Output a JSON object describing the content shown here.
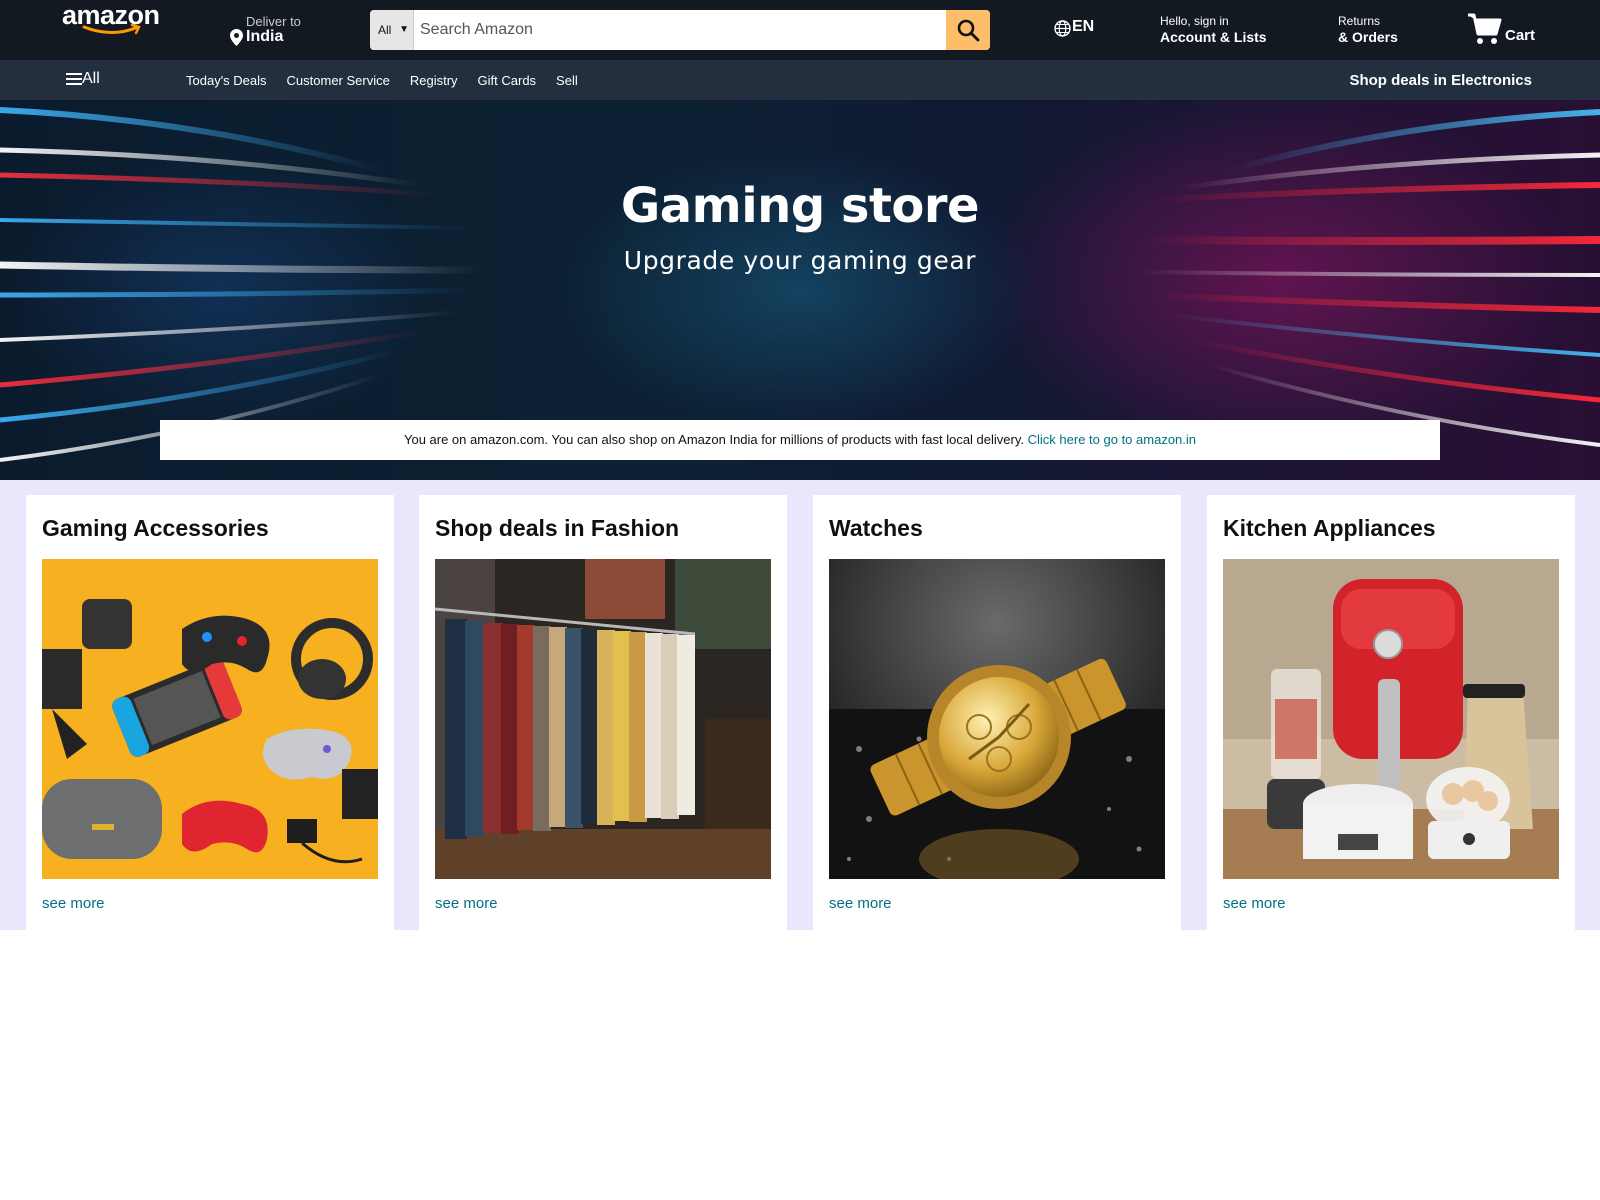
{
  "header": {
    "logo_text": "amazon",
    "deliver_label": "Deliver to",
    "deliver_location": "India",
    "search_category": "All",
    "search_placeholder": "Search Amazon",
    "language": "EN",
    "account_line1": "Hello, sign in",
    "account_line2": "Account & Lists",
    "returns_line1": "Returns",
    "returns_line2": "& Orders",
    "cart_label": "Cart"
  },
  "subnav": {
    "all_label": "All",
    "links": [
      "Today's Deals",
      "Customer Service",
      "Registry",
      "Gift Cards",
      "Sell"
    ],
    "promo": "Shop deals in Electronics"
  },
  "hero": {
    "title": "Gaming store",
    "subtitle": "Upgrade your gaming gear"
  },
  "notice": {
    "text": "You are on amazon.com. You can also shop on Amazon India for millions of products with fast local delivery.",
    "link": "Click here to go to amazon.in"
  },
  "cards": [
    {
      "title": "Gaming Accessories",
      "link": "see more"
    },
    {
      "title": "Shop deals in Fashion",
      "link": "see more"
    },
    {
      "title": "Watches",
      "link": "see more"
    },
    {
      "title": "Kitchen Appliances",
      "link": "see more"
    }
  ],
  "colors": {
    "nav_bg": "#131921",
    "subnav_bg": "#232f3e",
    "search_button": "#febd69",
    "link": "#007185",
    "cards_bg": "#e8e7fb"
  }
}
